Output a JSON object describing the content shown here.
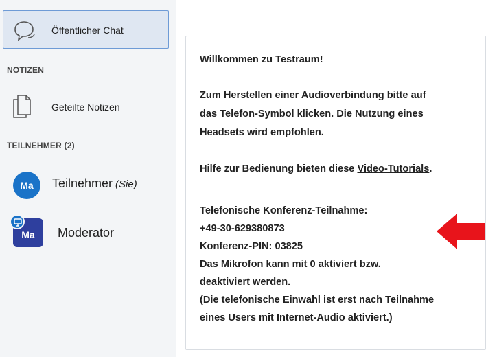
{
  "sidebar": {
    "chat": {
      "label": "Öffentlicher Chat",
      "icon": "speech-bubble-icon"
    },
    "notes": {
      "title": "NOTIZEN",
      "item_label": "Geteilte Notizen",
      "icon": "document-icon"
    },
    "users": {
      "title": "TEILNEHMER (2)",
      "list": [
        {
          "avatar": "Ma",
          "name": "Teilnehmer",
          "tag": "(Sie)",
          "avatar_color": "#1a73c8"
        },
        {
          "avatar": "Ma",
          "name": "Moderator",
          "avatar_color": "#2e3f9e",
          "badge": "presenter-icon"
        }
      ]
    }
  },
  "message": {
    "line1_prefix": "Willkommen zu ",
    "line1_room": "Testraum!",
    "audio1": "Zum Herstellen einer Audioverbindung bitte auf",
    "audio2": "das Telefon-Symbol klicken. Die Nutzung eines",
    "audio3": "Headsets wird empfohlen.",
    "help_prefix": "Hilfe zur Bedienung bieten diese ",
    "help_link": "Video-Tutorials",
    "help_suffix": ".",
    "phone_title": "Telefonische Konferenz-Teilnahme:",
    "phone_number": "+49-30-629380873",
    "pin": "Konferenz-PIN: 03825",
    "mic1": "Das Mikrofon kann mit 0 aktiviert bzw.",
    "mic2": "deaktiviert werden.",
    "note1": "(Die telefonische Einwahl ist erst nach Teilnahme",
    "note2": "eines Users mit Internet-Audio aktiviert.)"
  },
  "colors": {
    "arrow": "#e8141b",
    "accent": "#1a73c8"
  }
}
